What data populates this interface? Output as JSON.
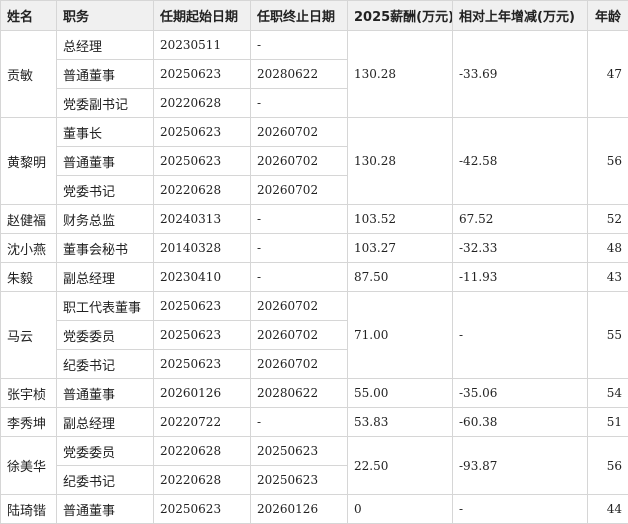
{
  "headers": [
    "姓名",
    "职务",
    "任期起始日期",
    "任职终止日期",
    "2025薪酬(万元)",
    "相对上年增减(万元)",
    "年龄"
  ],
  "people": [
    {
      "name": "贡敏",
      "salary": "130.28",
      "change": "-33.69",
      "age": "47",
      "roles": [
        {
          "title": "总经理",
          "start": "20230511",
          "end": "-"
        },
        {
          "title": "普通董事",
          "start": "20250623",
          "end": "20280622"
        },
        {
          "title": "党委副书记",
          "start": "20220628",
          "end": "-"
        }
      ]
    },
    {
      "name": "黄黎明",
      "salary": "130.28",
      "change": "-42.58",
      "age": "56",
      "roles": [
        {
          "title": "董事长",
          "start": "20250623",
          "end": "20260702"
        },
        {
          "title": "普通董事",
          "start": "20250623",
          "end": "20260702"
        },
        {
          "title": "党委书记",
          "start": "20220628",
          "end": "20260702"
        }
      ]
    },
    {
      "name": "赵健福",
      "salary": "103.52",
      "change": "67.52",
      "age": "52",
      "roles": [
        {
          "title": "财务总监",
          "start": "20240313",
          "end": "-"
        }
      ]
    },
    {
      "name": "沈小燕",
      "salary": "103.27",
      "change": "-32.33",
      "age": "48",
      "roles": [
        {
          "title": "董事会秘书",
          "start": "20140328",
          "end": "-"
        }
      ]
    },
    {
      "name": "朱毅",
      "salary": "87.50",
      "change": "-11.93",
      "age": "43",
      "roles": [
        {
          "title": "副总经理",
          "start": "20230410",
          "end": "-"
        }
      ]
    },
    {
      "name": "马云",
      "salary": "71.00",
      "change": "-",
      "age": "55",
      "roles": [
        {
          "title": "职工代表董事",
          "start": "20250623",
          "end": "20260702"
        },
        {
          "title": "党委委员",
          "start": "20250623",
          "end": "20260702"
        },
        {
          "title": "纪委书记",
          "start": "20250623",
          "end": "20260702"
        }
      ]
    },
    {
      "name": "张宇桢",
      "salary": "55.00",
      "change": "-35.06",
      "age": "54",
      "roles": [
        {
          "title": "普通董事",
          "start": "20260126",
          "end": "20280622"
        }
      ]
    },
    {
      "name": "李秀坤",
      "salary": "53.83",
      "change": "-60.38",
      "age": "51",
      "roles": [
        {
          "title": "副总经理",
          "start": "20220722",
          "end": "-"
        }
      ]
    },
    {
      "name": "徐美华",
      "salary": "22.50",
      "change": "-93.87",
      "age": "56",
      "roles": [
        {
          "title": "党委委员",
          "start": "20220628",
          "end": "20250623"
        },
        {
          "title": "纪委书记",
          "start": "20220628",
          "end": "20250623"
        }
      ]
    },
    {
      "name": "陆琦锴",
      "salary": "0",
      "change": "-",
      "age": "44",
      "roles": [
        {
          "title": "普通董事",
          "start": "20250623",
          "end": "20260126"
        }
      ]
    }
  ]
}
